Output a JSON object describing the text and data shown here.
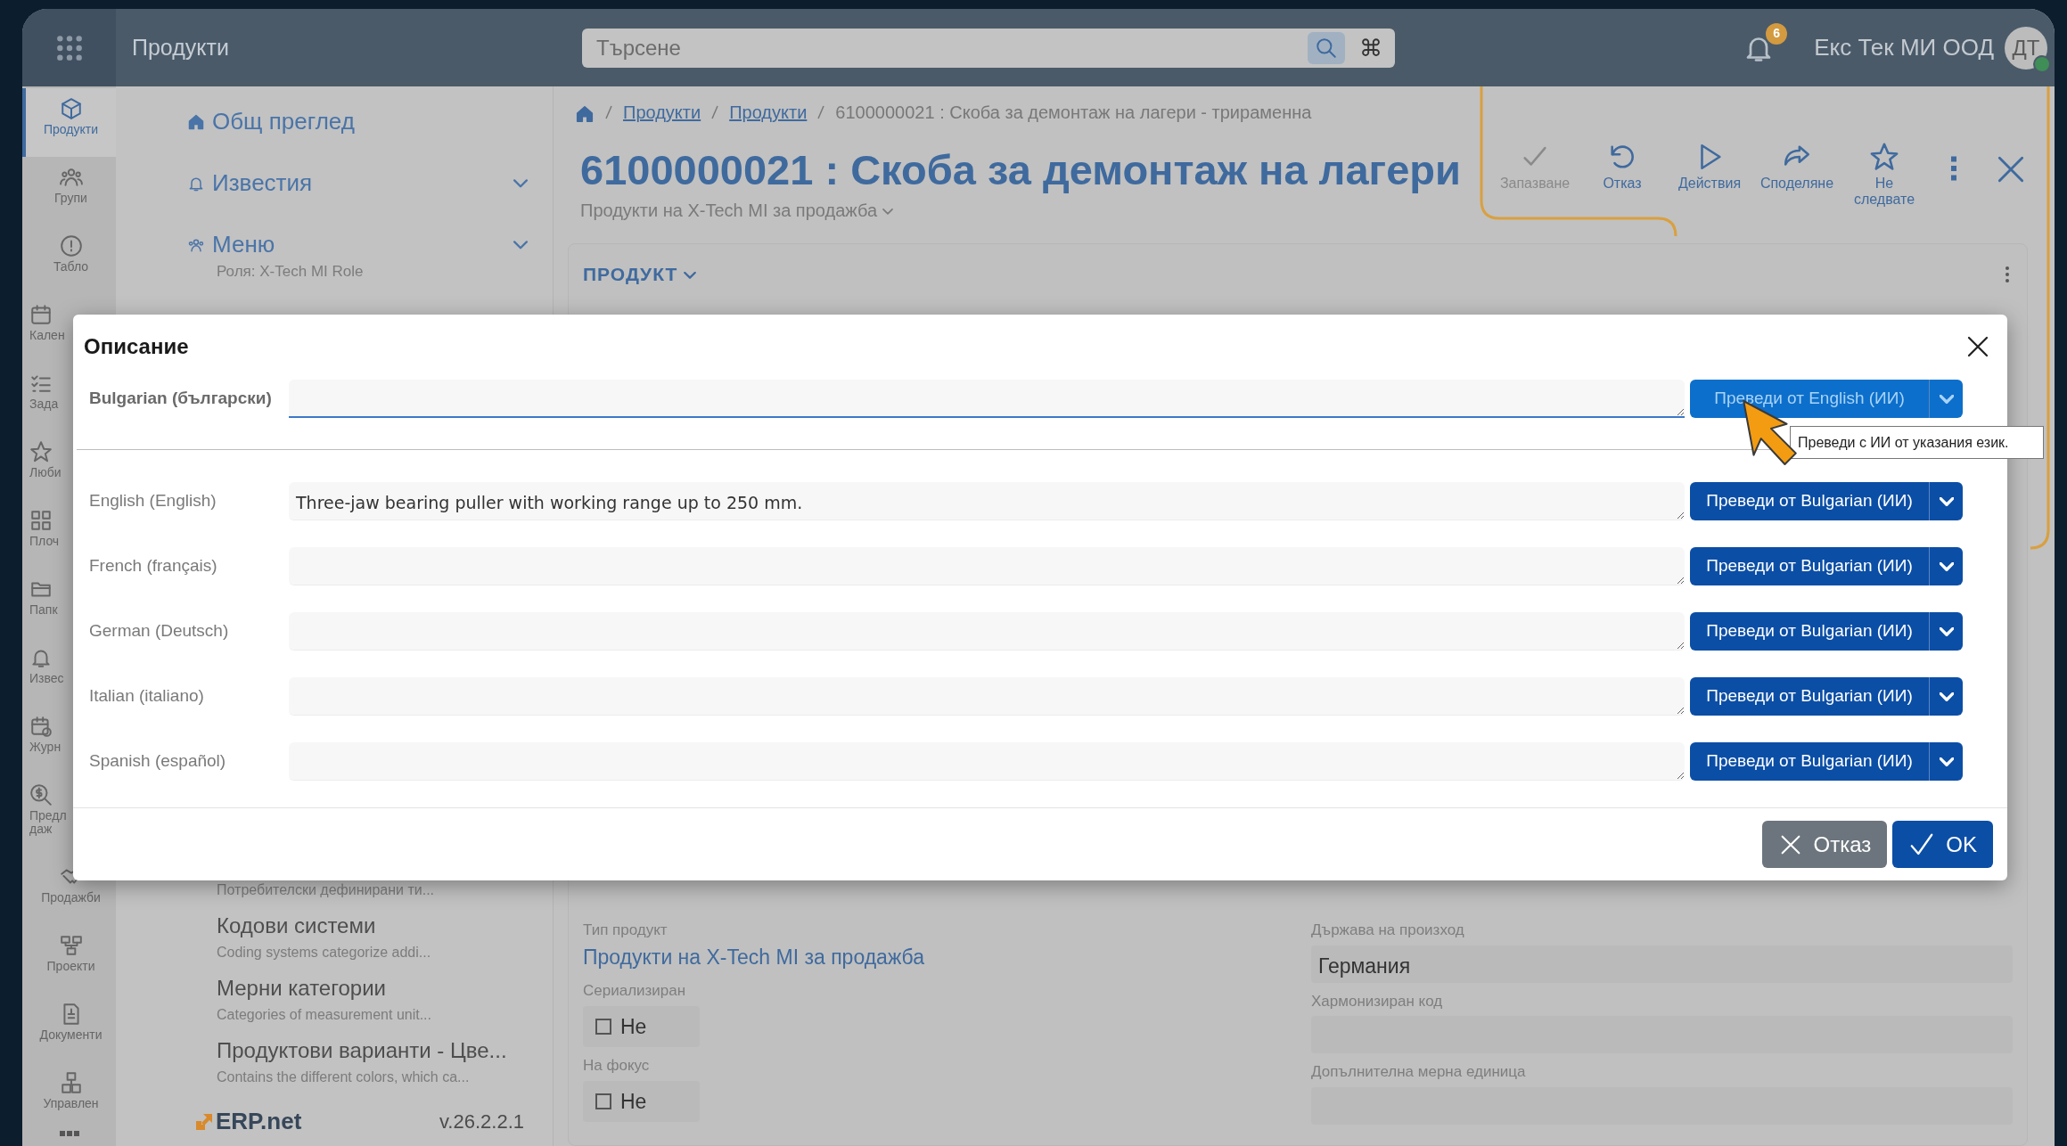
{
  "top_bar": {
    "module_title": "Продукти",
    "search": {
      "placeholder": "Търсене"
    },
    "shortcut_key": "⌘",
    "notifications_count": "6",
    "company": "Екс Тек МИ ООД",
    "avatar_initials": "ДТ",
    "user_online": true
  },
  "rail": [
    {
      "label": "Продукти",
      "selected": true
    },
    {
      "label": "Групи",
      "selected": false
    },
    {
      "label": "Табло",
      "selected": false
    },
    {
      "label": "Кален",
      "selected": false
    },
    {
      "label": "Зада",
      "selected": false
    },
    {
      "label": "Люби",
      "selected": false
    },
    {
      "label": "Плоч",
      "selected": false
    },
    {
      "label": "Папк",
      "selected": false
    },
    {
      "label": "Извес",
      "selected": false
    },
    {
      "label": "Журн",
      "selected": false
    },
    {
      "label": "Предл даж",
      "selected": false
    },
    {
      "label": "Продажби",
      "selected": false
    },
    {
      "label": "Проекти",
      "selected": false
    },
    {
      "label": "Документи",
      "selected": false
    },
    {
      "label": "Управлен",
      "selected": false
    }
  ],
  "sidebar": {
    "nav": [
      {
        "label": "Общ преглед",
        "expandable": false
      },
      {
        "label": "Известия",
        "expandable": true
      },
      {
        "label": "Меню",
        "subtitle": "Роля: X-Tech MI Role",
        "expandable": true
      }
    ],
    "entries": [
      {
        "description": "Потребителски дефинирани ти..."
      },
      {
        "title": "Кодови системи",
        "description": "Coding systems categorize addi..."
      },
      {
        "title": "Мерни категории",
        "description": "Categories of measurement unit..."
      },
      {
        "title": "Продуктови варианти - Цве...",
        "description": "Contains the different colors, which ca..."
      }
    ],
    "logo": "ERP.net",
    "version": "v.26.2.2.1"
  },
  "breadcrumb": [
    {
      "label": "Продукти",
      "link": true
    },
    {
      "label": "Продукти",
      "link": true
    },
    {
      "label": "6100000021 : Скоба за демонтаж на лагери - трираменна",
      "link": false
    }
  ],
  "header": {
    "title": "6100000021 : Скоба за демонтаж на лагери",
    "subtitle": "Продукти на X-Tech MI за продажба"
  },
  "toolbar": [
    {
      "label": "Запазване",
      "disabled": true
    },
    {
      "label": "Отказ",
      "disabled": false
    },
    {
      "label": "Действия",
      "disabled": false
    },
    {
      "label": "Споделяне",
      "disabled": false
    },
    {
      "label": "Не следвате",
      "disabled": false
    }
  ],
  "card": {
    "title": "ПРОДУКТ"
  },
  "form": {
    "left": [
      {
        "kind": "link",
        "label": "Тип продукт",
        "value": "Продукти на X-Tech MI за продажба"
      },
      {
        "kind": "checkbox",
        "label": "Сериализиран",
        "checked": false,
        "value": "Не"
      },
      {
        "kind": "checkbox",
        "label": "На фокус",
        "checked": false,
        "value": "Не"
      }
    ],
    "right": [
      {
        "kind": "text",
        "label": "Държава на произход",
        "value": "Германия"
      },
      {
        "kind": "text",
        "label": "Хармонизиран код"
      },
      {
        "kind": "text",
        "label": "Допълнителна мерна единица"
      }
    ]
  },
  "dialog": {
    "title": "Описание",
    "rows": [
      {
        "language": "Bulgarian (български)",
        "primary": true,
        "translate_button": "Преведи от English (ИИ)",
        "disabled": true
      },
      {
        "language": "English (English)",
        "primary": false,
        "value": "Three-jaw bearing puller with working range up to 250 mm.",
        "translate_button": "Преведи от Bulgarian (ИИ)",
        "disabled": false
      },
      {
        "language": "French (français)",
        "primary": false,
        "translate_button": "Преведи от Bulgarian (ИИ)",
        "disabled": false
      },
      {
        "language": "German (Deutsch)",
        "primary": false,
        "translate_button": "Преведи от Bulgarian (ИИ)",
        "disabled": false
      },
      {
        "language": "Italian (italiano)",
        "primary": false,
        "translate_button": "Преведи от Bulgarian (ИИ)",
        "disabled": false
      },
      {
        "language": "Spanish (español)",
        "primary": false,
        "translate_button": "Преведи от Bulgarian (ИИ)",
        "disabled": false
      }
    ],
    "tooltip": "Преведи с ИИ от указания език.",
    "buttons": [
      {
        "kind": "cancel",
        "label": "Отказ"
      },
      {
        "kind": "ok",
        "label": "OK"
      }
    ]
  }
}
